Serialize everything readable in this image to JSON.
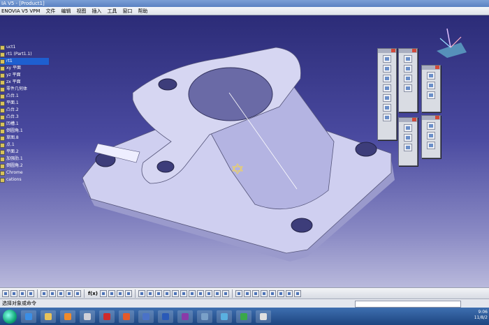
{
  "window": {
    "title": "IA V5 - [Product1]"
  },
  "menu": [
    "ENOVIA V5 VPM",
    "文件",
    "编辑",
    "视图",
    "插入",
    "工具",
    "窗口",
    "帮助"
  ],
  "tree": [
    {
      "label": "uct1",
      "selected": false
    },
    {
      "label": "rt1 (Part1.1)",
      "selected": false
    },
    {
      "label": "rt1",
      "selected": true
    },
    {
      "label": "xy 平面",
      "selected": false
    },
    {
      "label": "yz 平面",
      "selected": false
    },
    {
      "label": "zx 平面",
      "selected": false
    },
    {
      "label": "零件几何体",
      "selected": false
    },
    {
      "label": "凸台.1",
      "selected": false
    },
    {
      "label": "平面.1",
      "selected": false
    },
    {
      "label": "凸台.2",
      "selected": false
    },
    {
      "label": "凸台.3",
      "selected": false
    },
    {
      "label": "凹槽.1",
      "selected": false
    },
    {
      "label": "倒圆角.1",
      "selected": false
    },
    {
      "label": "草图.8",
      "selected": false
    },
    {
      "label": "点.1",
      "selected": false
    },
    {
      "label": "平面.2",
      "selected": false
    },
    {
      "label": "加强肋.1",
      "selected": false
    },
    {
      "label": "倒圆角.2",
      "selected": false
    },
    {
      "label": "Chrome",
      "selected": false
    },
    {
      "label": "cations",
      "selected": false
    }
  ],
  "status": {
    "prompt": "选择对象或命令"
  },
  "clock": {
    "time": "9:06",
    "date": "11/8/2"
  },
  "colors": {
    "background_top": "#2c2c78",
    "background_bottom": "#b9b9dc",
    "part": "#c9c9ea",
    "tree_selected": "#1e5fd0"
  }
}
